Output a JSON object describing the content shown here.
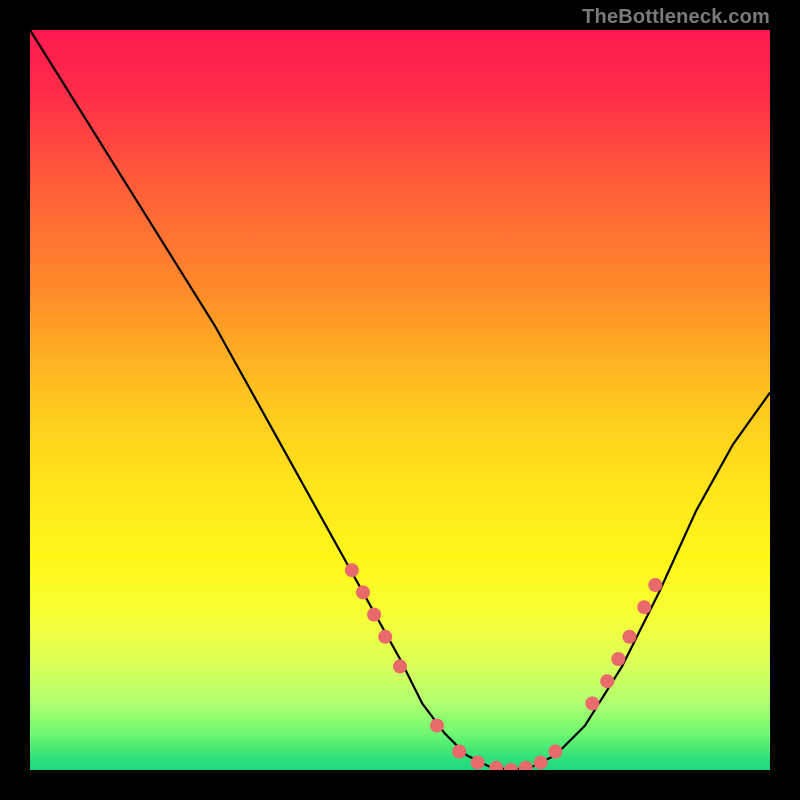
{
  "watermark": "TheBottleneck.com",
  "chart_data": {
    "type": "line",
    "title": "",
    "xlabel": "",
    "ylabel": "",
    "xlim": [
      0,
      100
    ],
    "ylim": [
      0,
      100
    ],
    "background_gradient_stops": [
      {
        "offset": 0.0,
        "color": "#ff1a4d"
      },
      {
        "offset": 0.08,
        "color": "#ff2a4a"
      },
      {
        "offset": 0.2,
        "color": "#ff5a3a"
      },
      {
        "offset": 0.35,
        "color": "#ff8a2a"
      },
      {
        "offset": 0.5,
        "color": "#ffc61f"
      },
      {
        "offset": 0.62,
        "color": "#ffe61a"
      },
      {
        "offset": 0.72,
        "color": "#fff71a"
      },
      {
        "offset": 0.8,
        "color": "#f4ff3a"
      },
      {
        "offset": 0.86,
        "color": "#d8ff5a"
      },
      {
        "offset": 0.91,
        "color": "#b0ff70"
      },
      {
        "offset": 0.95,
        "color": "#70f870"
      },
      {
        "offset": 0.985,
        "color": "#2De07a"
      },
      {
        "offset": 1.0,
        "color": "#1Ed882"
      }
    ],
    "series": [
      {
        "name": "bottleneck-curve",
        "x": [
          0,
          5,
          10,
          15,
          20,
          25,
          30,
          35,
          40,
          45,
          50,
          53,
          56,
          59,
          62,
          65,
          68,
          71,
          75,
          80,
          85,
          90,
          95,
          100
        ],
        "y": [
          100,
          92,
          84,
          76,
          68,
          60,
          51,
          42,
          33,
          24,
          15,
          9,
          5,
          2,
          0.5,
          0,
          0.5,
          2,
          6,
          14,
          24,
          35,
          44,
          51
        ]
      }
    ],
    "markers": [
      {
        "x": 43.5,
        "y": 27
      },
      {
        "x": 45.0,
        "y": 24
      },
      {
        "x": 46.5,
        "y": 21
      },
      {
        "x": 48.0,
        "y": 18
      },
      {
        "x": 50.0,
        "y": 14
      },
      {
        "x": 55.0,
        "y": 6
      },
      {
        "x": 58.0,
        "y": 2.5
      },
      {
        "x": 60.5,
        "y": 1
      },
      {
        "x": 63.0,
        "y": 0.3
      },
      {
        "x": 65.0,
        "y": 0
      },
      {
        "x": 67.0,
        "y": 0.3
      },
      {
        "x": 69.0,
        "y": 1
      },
      {
        "x": 71.0,
        "y": 2.5
      },
      {
        "x": 76.0,
        "y": 9
      },
      {
        "x": 78.0,
        "y": 12
      },
      {
        "x": 79.5,
        "y": 15
      },
      {
        "x": 81.0,
        "y": 18
      },
      {
        "x": 83.0,
        "y": 22
      },
      {
        "x": 84.5,
        "y": 25
      }
    ],
    "marker_color": "#e86a6a",
    "curve_color": "#000000"
  }
}
